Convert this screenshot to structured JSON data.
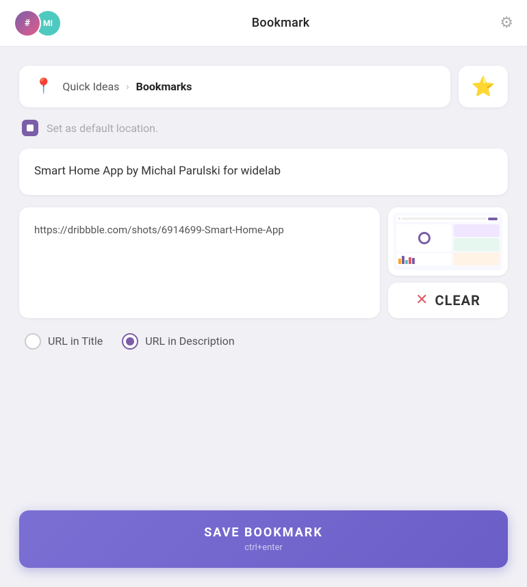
{
  "header": {
    "title": "Bookmark",
    "avatar1_label": "#",
    "avatar2_label": "MI"
  },
  "breadcrumb": {
    "location_icon": "📍",
    "parent": "Quick Ideas",
    "chevron": "›",
    "current": "Bookmarks"
  },
  "default_location": {
    "label": "Set as default location."
  },
  "title_card": {
    "text": "Smart Home App by Michal Parulski for widelab"
  },
  "url_card": {
    "text": "https://dribbble.com/shots/6914699-Smart-Home-App"
  },
  "clear_button": {
    "label": "CLEAR"
  },
  "radio": {
    "option1_label": "URL in Title",
    "option2_label": "URL in Description",
    "selected": "option2"
  },
  "save_button": {
    "label": "SAVE BOOKMARK",
    "shortcut": "ctrl+enter"
  },
  "colors": {
    "accent": "#7b5ea7",
    "star": "#f5a623",
    "clear_x": "#e05a6a"
  }
}
